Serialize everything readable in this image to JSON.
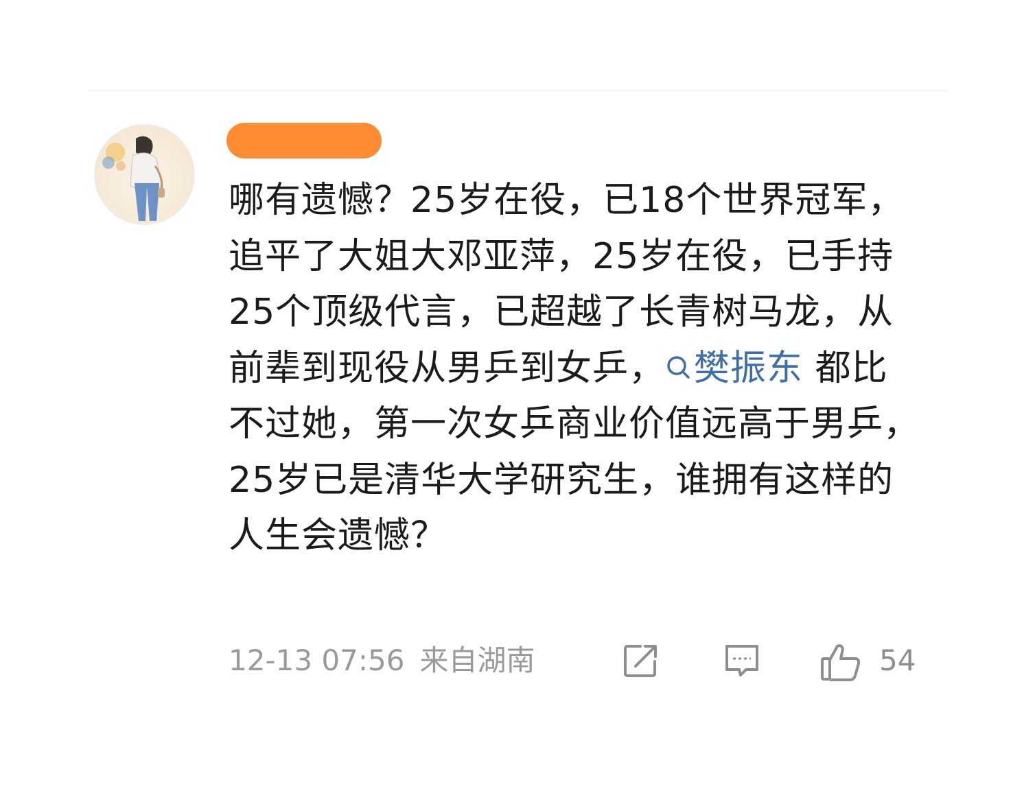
{
  "comment": {
    "text_part1": "哪有遗憾？25岁在役，已18个世界冠军，追平了大姐大邓亚萍，25岁在役，已手持25个顶级代言，已超越了长青树马龙，从前辈到现役从男乒到女乒，",
    "topic_link": "樊振东",
    "text_part2": "都比不过她，第一次女乒商业价值远高于男乒，25岁已是清华大学研究生，谁拥有这样的人生会遗憾？"
  },
  "meta": {
    "timestamp": "12-13 07:56",
    "source": "来自湖南"
  },
  "actions": {
    "share_icon": "share-icon",
    "reply_icon": "reply-icon",
    "like_icon": "thumbs-up-icon",
    "like_count": "54"
  },
  "colors": {
    "redaction": "#ff8c35",
    "link": "#3e6fa6",
    "meta_text": "#9a9a9a",
    "body_text": "#1b1b1b"
  }
}
